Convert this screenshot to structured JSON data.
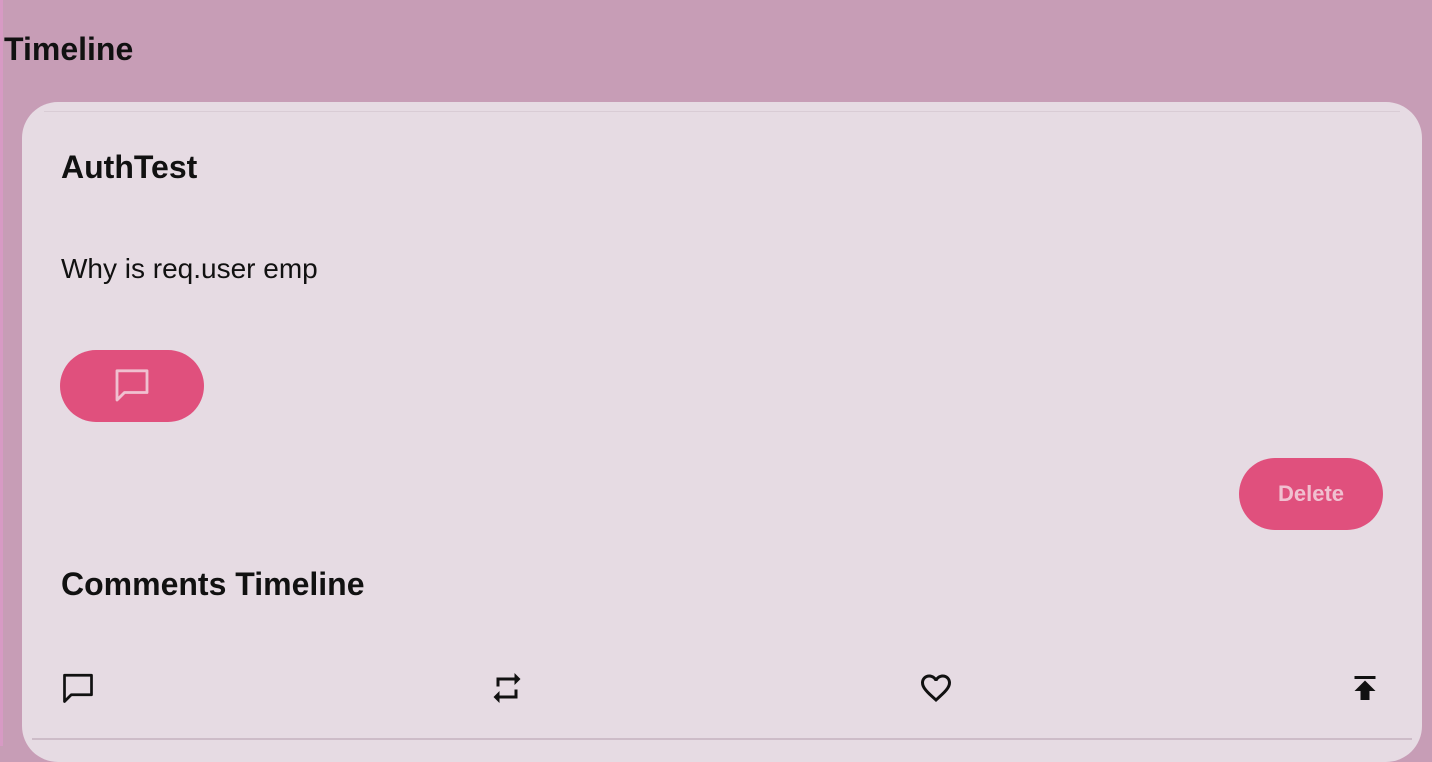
{
  "page": {
    "title": "Timeline"
  },
  "post": {
    "author": "AuthTest",
    "body": "Why is req.user emp",
    "comment_button_icon": "comment-icon",
    "delete_label": "Delete"
  },
  "comments": {
    "title": "Comments Timeline"
  },
  "actions": [
    {
      "icon": "comment-icon"
    },
    {
      "icon": "repost-icon"
    },
    {
      "icon": "heart-icon"
    },
    {
      "icon": "scroll-to-top-icon"
    }
  ],
  "colors": {
    "background": "#c79db6",
    "card": "#e6dbe3",
    "accent": "#e0507d",
    "accent_text": "#f0c0d0",
    "text": "#111111"
  }
}
